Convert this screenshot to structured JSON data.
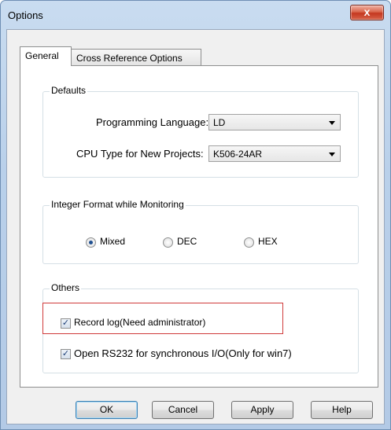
{
  "window": {
    "title": "Options",
    "close_label": "x"
  },
  "tabs": [
    {
      "label": "General",
      "active": true
    },
    {
      "label": "Cross Reference Options",
      "active": false
    }
  ],
  "defaults": {
    "group_title": "Defaults",
    "programming_language_label": "Programming Language:",
    "programming_language_value": "LD",
    "cpu_type_label": "CPU Type for New Projects:",
    "cpu_type_value": "K506-24AR"
  },
  "integer_format": {
    "group_title": "Integer Format while Monitoring",
    "options": [
      {
        "label": "Mixed",
        "checked": true
      },
      {
        "label": "DEC",
        "checked": false
      },
      {
        "label": "HEX",
        "checked": false
      }
    ]
  },
  "others": {
    "group_title": "Others",
    "record_log_label": "Record log(Need administrator)",
    "record_log_checked": true,
    "open_rs232_label": "Open RS232 for synchronous I/O(Only for win7)",
    "open_rs232_checked": true
  },
  "buttons": {
    "ok": "OK",
    "cancel": "Cancel",
    "apply": "Apply",
    "help": "Help"
  },
  "colors": {
    "highlight_box": "#d03a3a",
    "close_button": "#c4371f",
    "radio_dot": "#1f4f8f"
  }
}
